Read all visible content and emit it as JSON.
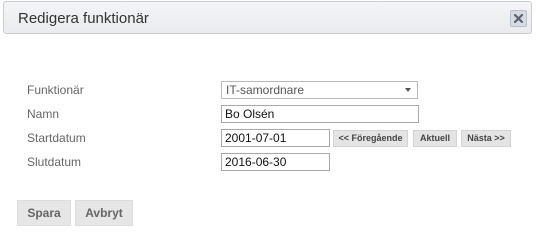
{
  "dialog": {
    "title": "Redigera funktionär",
    "close_icon": "close-icon"
  },
  "form": {
    "funktionar_label": "Funktionär",
    "funktionar_value": "IT-samordnare",
    "namn_label": "Namn",
    "namn_value": "Bo Olsén",
    "startdatum_label": "Startdatum",
    "startdatum_value": "2001-07-01",
    "slutdatum_label": "Slutdatum",
    "slutdatum_value": "2016-06-30",
    "prev_label": "<< Föregående",
    "current_label": "Aktuell",
    "next_label": "Nästa >>"
  },
  "actions": {
    "save_label": "Spara",
    "cancel_label": "Avbryt"
  }
}
